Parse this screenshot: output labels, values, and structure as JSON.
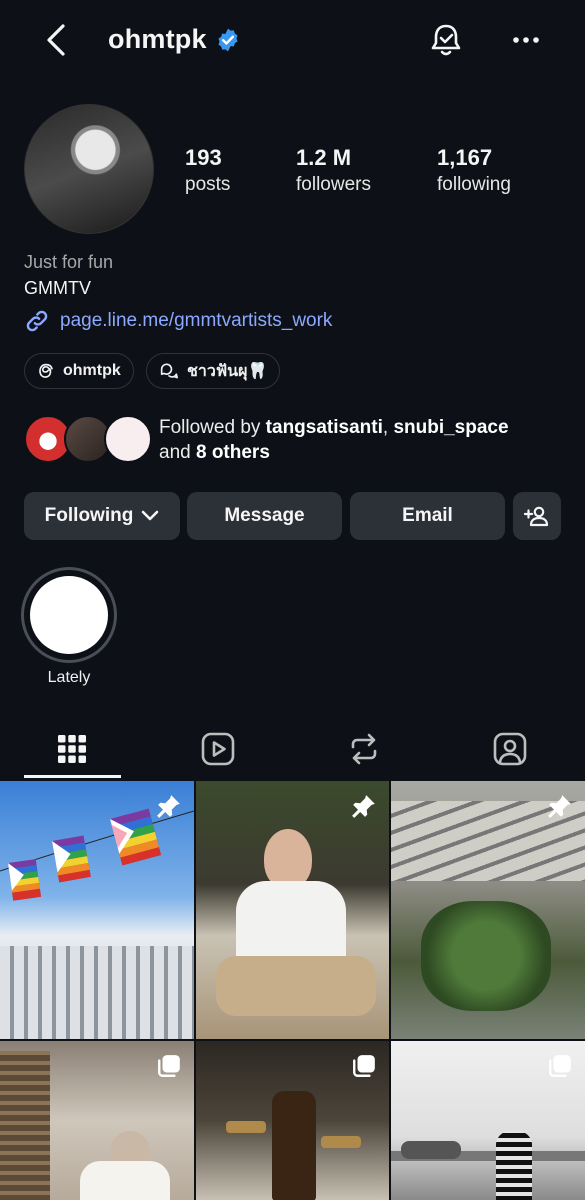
{
  "header": {
    "username": "ohmtpk",
    "verified": true,
    "icons": [
      "back-icon",
      "verified-badge-icon",
      "notification-bell-icon",
      "more-options-icon"
    ]
  },
  "stats": {
    "posts_count": "193",
    "posts_label": "posts",
    "followers_count": "1.2 M",
    "followers_label": "followers",
    "following_count": "1,167",
    "following_label": "following"
  },
  "bio": {
    "line1": "Just for fun",
    "line2": "GMMTV",
    "link": "page.line.me/gmmtvartists_work"
  },
  "chips": [
    {
      "label": "ohmtpk",
      "icon": "threads-icon"
    },
    {
      "label": "ชาวฟันผุ🦷",
      "icon": "chat-bubbles-icon"
    }
  ],
  "followed_by": {
    "prefix": "Followed by ",
    "user1": "tangsatisanti",
    "separator": ", ",
    "user2": "snubi_space",
    "and": "and ",
    "others": "8 others"
  },
  "actions": {
    "following": "Following",
    "message": "Message",
    "email": "Email"
  },
  "highlights": [
    {
      "label": "Lately"
    }
  ],
  "tabs": [
    "grid-icon",
    "reels-icon",
    "reposts-icon",
    "tagged-icon"
  ],
  "colors": {
    "background": "#0d1117",
    "button": "#2c3138",
    "link": "#8ca9ff",
    "verified": "#3897f0"
  }
}
